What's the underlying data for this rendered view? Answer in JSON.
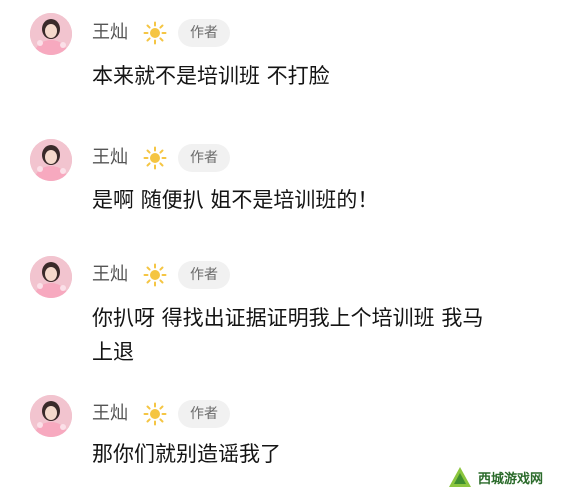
{
  "comments": [
    {
      "username": "王灿",
      "badge": "作者",
      "text": "本来就不是培训班 不打脸"
    },
    {
      "username": "王灿",
      "badge": "作者",
      "text": "是啊 随便扒 姐不是培训班的！"
    },
    {
      "username": "王灿",
      "badge": "作者",
      "text_line1": "你扒呀 得找出证据证明我上个培训班 我马",
      "text_line2": "上退"
    },
    {
      "username": "王灿",
      "badge": "作者",
      "text": "那你们就别造谣我了"
    }
  ],
  "watermark": {
    "text": "西城游戏网"
  },
  "colors": {
    "badge_bg": "#f1f1f1",
    "sun": "#f5c542",
    "avatar": "#e9a8b8"
  },
  "icons": {
    "level": "sun-icon",
    "avatar": "avatar"
  }
}
